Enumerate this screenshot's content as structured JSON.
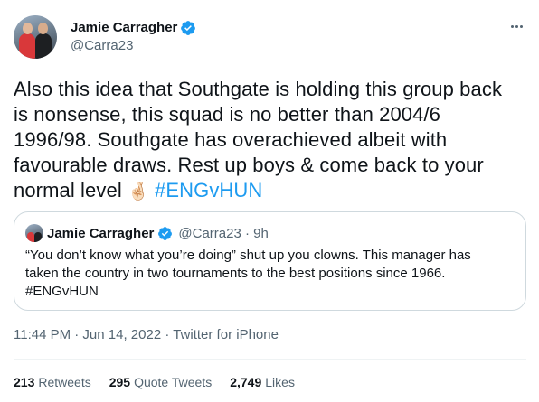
{
  "author": {
    "display_name": "Jamie Carragher",
    "handle": "@Carra23",
    "verified_icon": "verified-badge-icon",
    "avatar_icon": "profile-photo"
  },
  "tweet": {
    "lines": [
      "Also this idea that Southgate is holding this group back",
      "is nonsense, this squad is no better than 2004/6",
      "1996/98. Southgate has overachieved albeit with",
      "favourable draws. Rest up boys & come back to your"
    ],
    "last_line_text": "normal level",
    "emoji": "🤞🏻",
    "hashtag": "#ENGvHUN"
  },
  "quoted_tweet": {
    "display_name": "Jamie Carragher",
    "handle_time": "@Carra23 · 9h",
    "lines": [
      "“You don’t know what you’re doing” shut up you clowns. This manager has",
      "taken the country in two tournaments to the best positions since 1966.",
      "#ENGvHUN"
    ]
  },
  "meta": "11:44 PM · Jun 14, 2022 · Twitter for iPhone",
  "stats": [
    {
      "count": "213",
      "label": "Retweets"
    },
    {
      "count": "295",
      "label": "Quote Tweets"
    },
    {
      "count": "2,749",
      "label": "Likes"
    }
  ],
  "colors": {
    "accent": "#1d9bf0",
    "text_primary": "#0f1419",
    "text_secondary": "#536471",
    "border": "#cfd9de"
  }
}
